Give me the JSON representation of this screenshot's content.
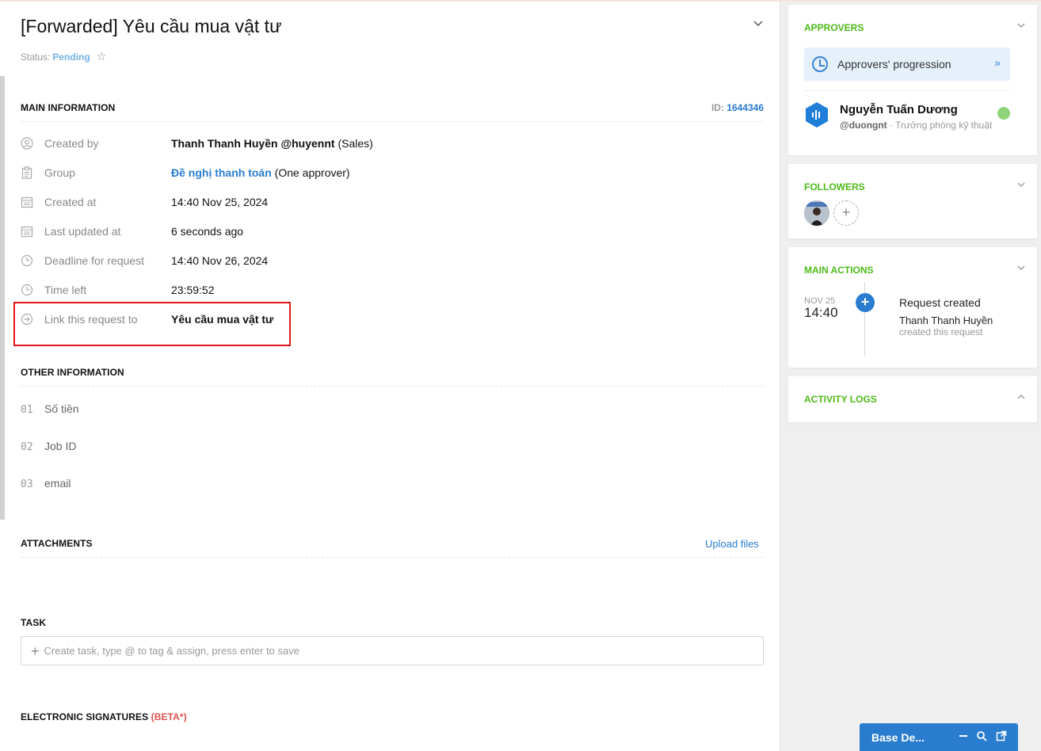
{
  "request": {
    "title": "[Forwarded] Yêu cầu mua vật tư",
    "status_label": "Status:",
    "status_value": "Pending"
  },
  "main_info": {
    "heading": "MAIN INFORMATION",
    "id_label": "ID:",
    "id_value": "1644346",
    "rows": [
      {
        "label": "Created by",
        "value": "Thanh Thanh Huyền @huyennt",
        "extra": "(Sales)",
        "icon": "user-circle-icon"
      },
      {
        "label": "Group",
        "value": "Đề nghị thanh toán",
        "extra": "(One approver)",
        "icon": "clipboard-icon"
      },
      {
        "label": "Created at",
        "value": "14:40 Nov 25, 2024",
        "icon": "calendar-icon"
      },
      {
        "label": "Last updated at",
        "value": "6 seconds ago",
        "icon": "calendar-icon"
      },
      {
        "label": "Deadline for request",
        "value": "14:40 Nov 26, 2024",
        "icon": "clock-icon"
      },
      {
        "label": "Time left",
        "value": "23:59:52",
        "icon": "clock-icon"
      },
      {
        "label": "Link this request to",
        "value": "Yêu cầu mua vật tư",
        "icon": "arrow-circle-icon"
      }
    ]
  },
  "other_info": {
    "heading": "OTHER INFORMATION",
    "fields": [
      {
        "num": "01",
        "label": "Số tiền"
      },
      {
        "num": "02",
        "label": "Job ID"
      },
      {
        "num": "03",
        "label": "email"
      }
    ]
  },
  "attachments": {
    "heading": "ATTACHMENTS",
    "upload_label": "Upload files"
  },
  "task": {
    "heading": "TASK",
    "placeholder": "Create task, type @ to tag & assign, press enter to save"
  },
  "signatures": {
    "heading": "ELECTRONIC SIGNATURES",
    "beta": "(BETA*)"
  },
  "sidebar": {
    "approvers": {
      "heading": "APPROVERS",
      "progression_label": "Approvers' progression",
      "approver_name": "Nguyễn Tuấn Dương",
      "approver_handle": "@duongnt",
      "approver_role": "· Trưởng phòng kỹ thuật"
    },
    "followers": {
      "heading": "FOLLOWERS"
    },
    "main_actions": {
      "heading": "MAIN ACTIONS",
      "date": "NOV 25",
      "time": "14:40",
      "title": "Request created",
      "who": "Thanh Thanh Huyền",
      "desc": "created this request"
    },
    "activity_logs": {
      "heading": "ACTIVITY LOGS"
    }
  },
  "chat": {
    "title": "Base De..."
  },
  "colors": {
    "accent_blue": "#2a7ccf",
    "section_green": "#4cbb17",
    "highlight_red": "#e0161b"
  }
}
